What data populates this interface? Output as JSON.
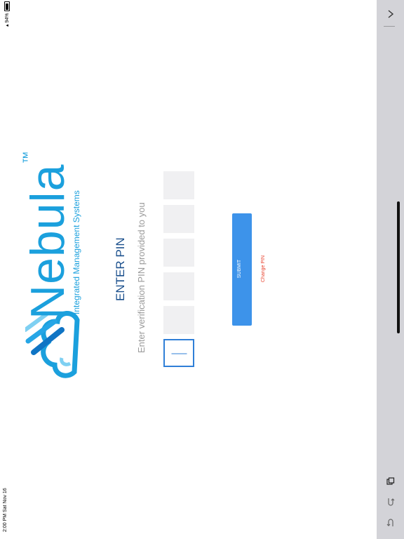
{
  "status_bar": {
    "time": "2:00 PM   Sat Nov 16",
    "battery": "94%"
  },
  "brand": {
    "name": "Nebula",
    "trademark": "™",
    "tagline": "Integrated Management Systems"
  },
  "pin_screen": {
    "title": "ENTER PIN",
    "subtitle": "Enter verification PIN provided to you",
    "digits": [
      "",
      "",
      "",
      "",
      "",
      ""
    ],
    "submit_label": "SUBMIT",
    "change_pin_label": "Change PIN"
  },
  "toolbar": {
    "icons": [
      "chevron-right-icon",
      "copy-icon",
      "redo-icon",
      "undo-icon"
    ]
  },
  "colors": {
    "brand": "#1ba0dd",
    "title": "#1a4f8c",
    "submit": "#3d93ea",
    "change_pin": "#e8412c",
    "toolbar_bg": "#d3d3d8"
  }
}
